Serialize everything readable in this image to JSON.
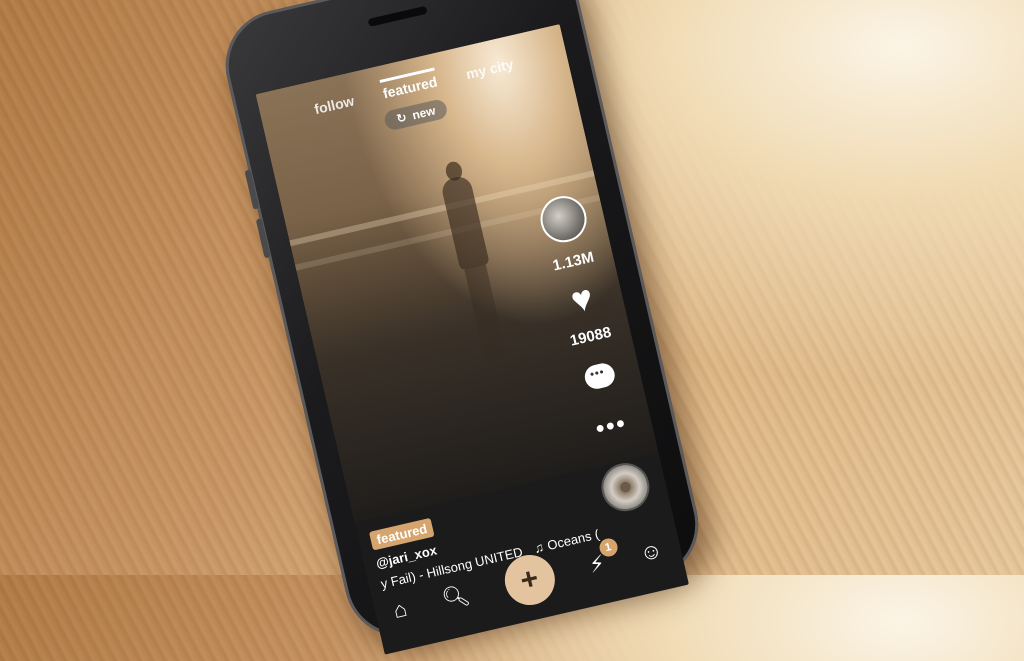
{
  "top_tabs": [
    {
      "label": "follow"
    },
    {
      "label": "featured"
    },
    {
      "label": "my city"
    }
  ],
  "new_pill": {
    "label": "new",
    "icon": "refresh-icon"
  },
  "right_rail": {
    "count_top": "1.13M",
    "likes": "19088",
    "icons": [
      "avatar",
      "heart-icon",
      "comment-icon",
      "more-icon",
      "music-disc"
    ]
  },
  "caption": {
    "badge": "featured",
    "username": "@jari_xox",
    "song_left": "y Fail) - Hillsong UNITED",
    "song_right": "Oceans ("
  },
  "bottom_nav": {
    "plus_label": "+",
    "notification_count": "1",
    "icons": [
      "home-icon",
      "search-icon",
      "plus-icon",
      "bolt-icon",
      "profile-icon"
    ]
  },
  "colors": {
    "accent": "#d6a56e",
    "plus_button": "#e3c49f"
  }
}
